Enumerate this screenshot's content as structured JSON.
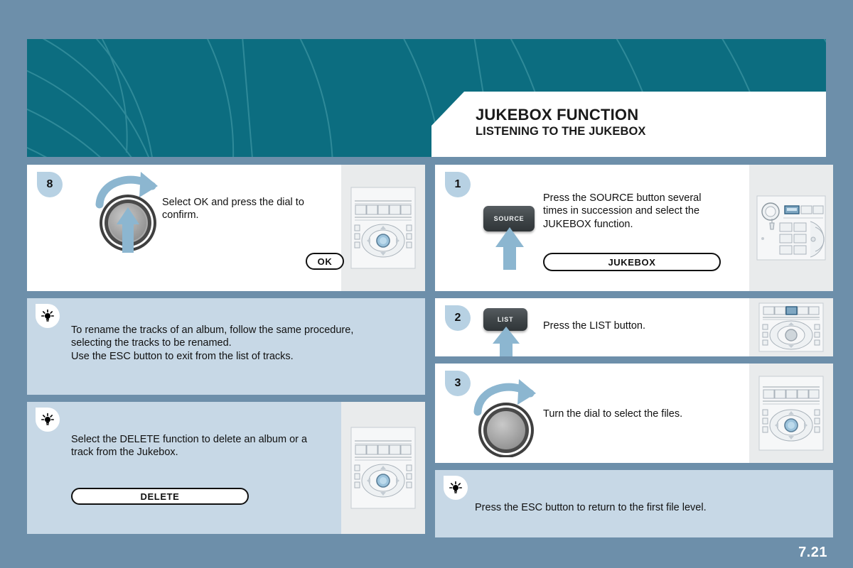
{
  "page": {
    "number": "7.21",
    "background_color": "#6d8faa",
    "accent_teal": "#0c6d80",
    "tip_panel_color": "#c7d8e6",
    "badge_color": "#b7d1e3",
    "arrow_color": "#8cb6d0"
  },
  "header": {
    "title": "JUKEBOX FUNCTION",
    "subtitle": "LISTENING TO THE JUKEBOX"
  },
  "left_column": {
    "panels": [
      {
        "kind": "step",
        "badge": "8",
        "text": "Select OK and press the dial to\nconfirm.",
        "graphic": "rotary-dial-turn-and-press",
        "pill_label": "OK",
        "thumbnail": "steering-wheel-controls"
      },
      {
        "kind": "tip",
        "icon": "tip-bulb-icon",
        "text": "To rename the tracks of an album, follow the same procedure,\nselecting the tracks to be renamed.\nUse the ESC button to exit from the list of tracks."
      },
      {
        "kind": "tip",
        "icon": "tip-bulb-icon",
        "text": "Select the DELETE function to delete an album or a\ntrack from the Jukebox.",
        "pill_label": "DELETE",
        "thumbnail": "steering-wheel-controls"
      }
    ]
  },
  "right_column": {
    "panels": [
      {
        "kind": "step",
        "badge": "1",
        "text": "Press the SOURCE button several\ntimes in succession and select the\nJUKEBOX function.",
        "button_label": "SOURCE",
        "pill_label": "JUKEBOX",
        "thumbnail": "radio-faceplate"
      },
      {
        "kind": "step",
        "badge": "2",
        "text": "Press the LIST button.",
        "button_label": "LIST",
        "thumbnail": "steering-wheel-controls"
      },
      {
        "kind": "step",
        "badge": "3",
        "text": "Turn the dial to select the files.",
        "graphic": "rotary-dial-turn",
        "thumbnail": "steering-wheel-controls"
      },
      {
        "kind": "tip",
        "icon": "tip-bulb-icon",
        "text": "Press the ESC button to return to the first file level."
      }
    ]
  }
}
